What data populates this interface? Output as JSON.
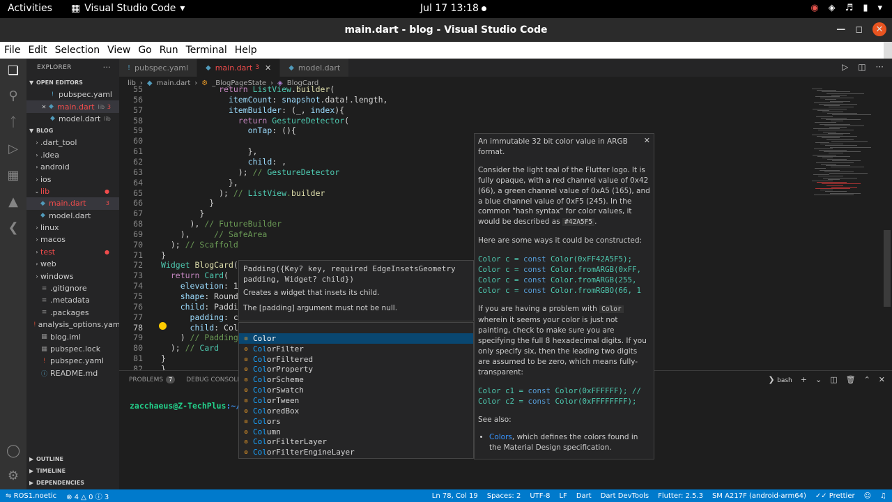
{
  "gnome": {
    "activities": "Activities",
    "app_name": "Visual Studio Code",
    "clock": "Jul 17  13:18"
  },
  "window": {
    "title": "main.dart - blog - Visual Studio Code"
  },
  "menu": [
    "File",
    "Edit",
    "Selection",
    "View",
    "Go",
    "Run",
    "Terminal",
    "Help"
  ],
  "explorer": {
    "header": "EXPLORER",
    "open_editors_label": "OPEN EDITORS",
    "open_editors": [
      {
        "name": "pubspec.yaml",
        "desc": ""
      },
      {
        "name": "main.dart",
        "desc": "lib",
        "badge": "3"
      },
      {
        "name": "model.dart",
        "desc": "lib"
      }
    ],
    "project_label": "BLOG",
    "tree": [
      {
        "name": ".dart_tool",
        "folder": true
      },
      {
        "name": ".idea",
        "folder": true
      },
      {
        "name": "android",
        "folder": true
      },
      {
        "name": "ios",
        "folder": true
      },
      {
        "name": "lib",
        "folder": true,
        "open": true,
        "err": true
      },
      {
        "name": "main.dart",
        "indent": true,
        "active": true,
        "err": true,
        "badge": "3"
      },
      {
        "name": "model.dart",
        "indent": true
      },
      {
        "name": "linux",
        "folder": true
      },
      {
        "name": "macos",
        "folder": true
      },
      {
        "name": "test",
        "folder": true,
        "err": true
      },
      {
        "name": "web",
        "folder": true
      },
      {
        "name": "windows",
        "folder": true
      },
      {
        "name": ".gitignore"
      },
      {
        "name": ".metadata"
      },
      {
        "name": ".packages"
      },
      {
        "name": "analysis_options.yaml"
      },
      {
        "name": "blog.iml"
      },
      {
        "name": "pubspec.lock"
      },
      {
        "name": "pubspec.yaml"
      },
      {
        "name": "README.md"
      }
    ],
    "outline": "OUTLINE",
    "timeline": "TIMELINE",
    "dependencies": "DEPENDENCIES"
  },
  "tabs": [
    {
      "name": "pubspec.yaml",
      "active": false
    },
    {
      "name": "main.dart",
      "active": true,
      "errors": "3"
    },
    {
      "name": "model.dart",
      "active": false
    }
  ],
  "breadcrumb": [
    "lib",
    "main.dart",
    "_BlogPageState",
    "BlogCard"
  ],
  "code": {
    "lines": [
      {
        "n": "55",
        "t": "            return ListView.builder("
      },
      {
        "n": "56",
        "t": "              itemCount: snapshot.data!.length,"
      },
      {
        "n": "57",
        "t": "              itemBuilder: (_, index){"
      },
      {
        "n": "58",
        "t": "                return GestureDetector("
      },
      {
        "n": "59",
        "t": "                  onTap: (){"
      },
      {
        "n": "60",
        "t": ""
      },
      {
        "n": "61",
        "t": "                  },"
      },
      {
        "n": "62",
        "t": "                  child: ,"
      },
      {
        "n": "63",
        "t": "                ); // GestureDetector"
      },
      {
        "n": "64",
        "t": "              },"
      },
      {
        "n": "65",
        "t": "            ); // ListView.builder"
      },
      {
        "n": "66",
        "t": "          }"
      },
      {
        "n": "67",
        "t": "        }"
      },
      {
        "n": "68",
        "t": "      ), // FutureBuilder"
      },
      {
        "n": "69",
        "t": "    ),     // SafeArea"
      },
      {
        "n": "70",
        "t": "  ); // Scaffold"
      },
      {
        "n": "71",
        "t": "}"
      },
      {
        "n": "72",
        "t": "Widget BlogCard("
      },
      {
        "n": "73",
        "t": "  return Card("
      },
      {
        "n": "74",
        "t": "    elevation: 1"
      },
      {
        "n": "75",
        "t": "    shape: Round"
      },
      {
        "n": "76",
        "t": "    child: Paddi"
      },
      {
        "n": "77",
        "t": "      padding: c"
      },
      {
        "n": "78",
        "t": "      child: Col"
      },
      {
        "n": "79",
        "t": "    ) // Padding"
      },
      {
        "n": "80",
        "t": "  ); // Card"
      },
      {
        "n": "81",
        "t": "}"
      },
      {
        "n": "82",
        "t": "}"
      }
    ]
  },
  "param_hint": {
    "signature": "Padding({Key? key, required EdgeInsetsGeometry padding, Widget? child})",
    "doc1": "Creates a widget that insets its child.",
    "doc2": "The [padding] argument must not be null."
  },
  "suggestions": [
    {
      "match": "Col",
      "rest": "or",
      "selected": true
    },
    {
      "match": "Col",
      "rest": "orFilter"
    },
    {
      "match": "Col",
      "rest": "orFiltered"
    },
    {
      "match": "Col",
      "rest": "orProperty"
    },
    {
      "match": "Col",
      "rest": "orScheme"
    },
    {
      "match": "Col",
      "rest": "orSwatch"
    },
    {
      "match": "Col",
      "rest": "orTween"
    },
    {
      "match": "Col",
      "rest": "oredBox"
    },
    {
      "match": "Col",
      "rest": "ors"
    },
    {
      "match": "Col",
      "rest": "umn"
    },
    {
      "match": "Col",
      "rest": "orFilterLayer"
    },
    {
      "match": "Col",
      "rest": "orFilterEngineLayer"
    }
  ],
  "doc": {
    "p1": "An immutable 32 bit color value in ARGB format.",
    "p2": "Consider the light teal of the Flutter logo. It is fully opaque, with a red channel value of 0x42 (66), a green channel value of 0xA5 (165), and a blue channel value of 0xF5 (245). In the common \"hash syntax\" for color values, it would be described as",
    "p2_code": "#42A5F5",
    "p2_end": ".",
    "p3": "Here are some ways it could be constructed:",
    "code1": [
      [
        "Color c = ",
        "const",
        " Color(0xFF42A5F5);"
      ],
      [
        "Color c = ",
        "const",
        " Color.fromARGB(0xFF,"
      ],
      [
        "Color c = ",
        "const",
        " Color.fromARGB(255,"
      ],
      [
        "Color c = ",
        "const",
        " Color.fromRGBO(66, 1"
      ]
    ],
    "p4a": "If you are having a problem with",
    "p4_code": "Color",
    "p4b": "wherein it seems your color is just not painting, check to make sure you are specifying the full 8 hexadecimal digits. If you only specify six, then the leading two digits are assumed to be zero, which means fully-transparent:",
    "code2": [
      [
        "Color c1 = ",
        "const",
        " Color(0xFFFFFF); //"
      ],
      [
        "Color c2 = ",
        "const",
        " Color(0xFFFFFFFF);"
      ]
    ],
    "see_also": "See also:",
    "li_link": "Colors",
    "li_rest": ", which defines the colors found in the Material Design specification."
  },
  "panel": {
    "problems": "PROBLEMS",
    "problems_count": "7",
    "debug": "DEBUG CONSOLE",
    "shell": "bash",
    "prompt_user": "zacchaeus@Z-TechPlus",
    "prompt_path": ":~/D"
  },
  "status": {
    "remote": "ROS1.noetic",
    "errors": "4",
    "warnings": "0",
    "infos": "3",
    "position": "Ln 78, Col 19",
    "spaces": "Spaces: 2",
    "encoding": "UTF-8",
    "eol": "LF",
    "language": "Dart",
    "devtools": "Dart DevTools",
    "flutter": "Flutter: 2.5.3",
    "device": "SM A217F (android-arm64)",
    "prettier": "Prettier"
  },
  "colors": {
    "accent": "#007acc",
    "error": "#f14c4c",
    "selection": "#094771"
  }
}
